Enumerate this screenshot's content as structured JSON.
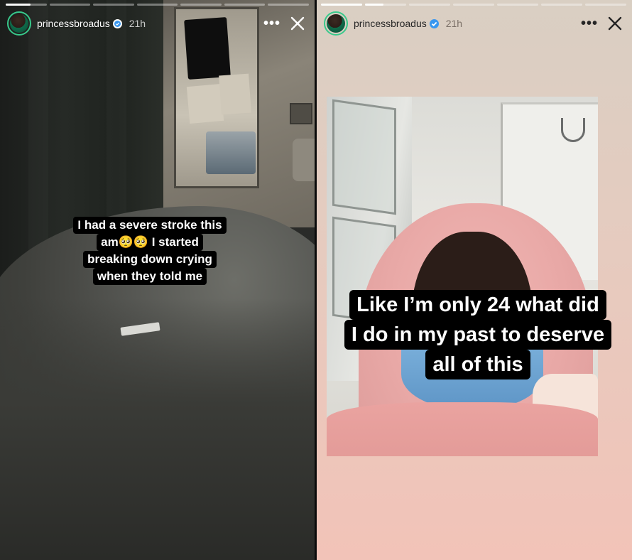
{
  "stories": [
    {
      "user": {
        "username": "princessbroadus",
        "timestamp": "21h",
        "verified": true
      },
      "progress": {
        "segments": 7,
        "current_index": 0,
        "current_fill": 0.6
      },
      "caption_lines": [
        "I had a severe stroke this",
        "am🥺🥺 I started",
        "breaking down crying",
        "when they told me"
      ],
      "menu_label": "•••"
    },
    {
      "user": {
        "username": "princessbroadus",
        "timestamp": "21h",
        "verified": true
      },
      "progress": {
        "segments": 7,
        "current_index": 1,
        "current_fill": 0.45
      },
      "caption_lines": [
        "Like I’m only 24 what did",
        "I do in my past to deserve",
        "all of this"
      ],
      "menu_label": "•••"
    }
  ],
  "colors": {
    "avatar_ring": "#38c98b",
    "caption_bg": "#000000",
    "caption_text": "#ffffff"
  },
  "icons": {
    "verified": "verified-badge-icon",
    "menu": "more-options-icon",
    "close": "close-icon"
  }
}
